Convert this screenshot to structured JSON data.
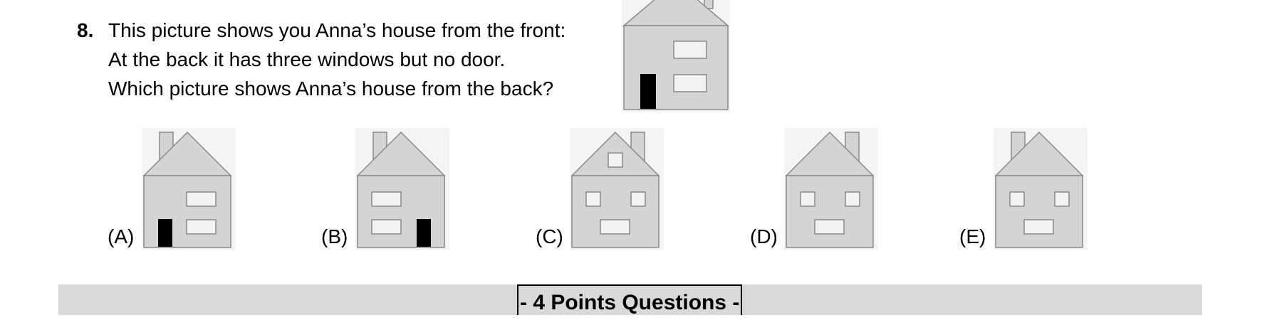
{
  "question": {
    "number": "8.",
    "lines": [
      "This picture shows you Anna’s house from the front:",
      "At the back it has three windows but no door.",
      "Which picture shows Anna’s house from the back?"
    ]
  },
  "front_house": {
    "icon": "house-front-icon",
    "chimney": "right",
    "door": "left",
    "windows": [
      "right-upper",
      "right-lower"
    ]
  },
  "options": [
    {
      "label": "(A)",
      "chimney": "left",
      "door": "left",
      "windows": [
        "right-upper",
        "right-lower"
      ],
      "icon": "house-icon"
    },
    {
      "label": "(B)",
      "chimney": "left",
      "door": "right",
      "windows": [
        "left-upper",
        "left-lower"
      ],
      "icon": "house-icon"
    },
    {
      "label": "(C)",
      "chimney": "right",
      "door": "none",
      "windows": [
        "roof",
        "left",
        "right",
        "center-lower"
      ],
      "icon": "house-icon"
    },
    {
      "label": "(D)",
      "chimney": "right",
      "door": "none",
      "windows": [
        "left",
        "right",
        "center-lower"
      ],
      "icon": "house-icon"
    },
    {
      "label": "(E)",
      "chimney": "left",
      "door": "none",
      "windows": [
        "left",
        "right",
        "center-lower"
      ],
      "icon": "house-icon"
    }
  ],
  "section": {
    "title": "- 4 Points Questions -"
  },
  "colors": {
    "house_fill": "#d4d4d4",
    "house_stroke": "#8a8a8a",
    "door": "#000000",
    "window_fill": "#f2f2f2",
    "icon_background": "#f4f4f4",
    "section_bar": "#d9d9d9"
  }
}
